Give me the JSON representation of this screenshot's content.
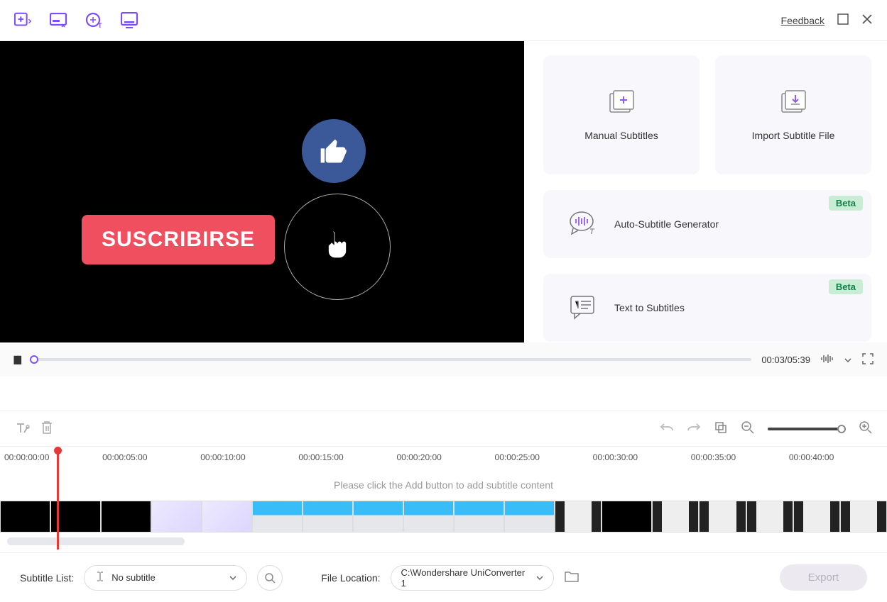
{
  "header": {
    "feedback": "Feedback"
  },
  "video": {
    "subscribe_label": "SUSCRIBIRSE"
  },
  "player": {
    "time": "00:03/05:39"
  },
  "side": {
    "manual": "Manual Subtitles",
    "import": "Import Subtitle File",
    "auto": "Auto-Subtitle Generator",
    "tts": "Text to Subtitles",
    "beta": "Beta"
  },
  "timeline": {
    "marks": [
      "00:00:00:00",
      "00:00:05:00",
      "00:00:10:00",
      "00:00:15:00",
      "00:00:20:00",
      "00:00:25:00",
      "00:00:30:00",
      "00:00:35:00",
      "00:00:40:00"
    ],
    "hint": "Please click the Add button to add subtitle content"
  },
  "footer": {
    "subtitle_list_label": "Subtitle List:",
    "subtitle_value": "No subtitle",
    "file_location_label": "File Location:",
    "file_location_value": "C:\\Wondershare UniConverter 1",
    "export": "Export"
  }
}
